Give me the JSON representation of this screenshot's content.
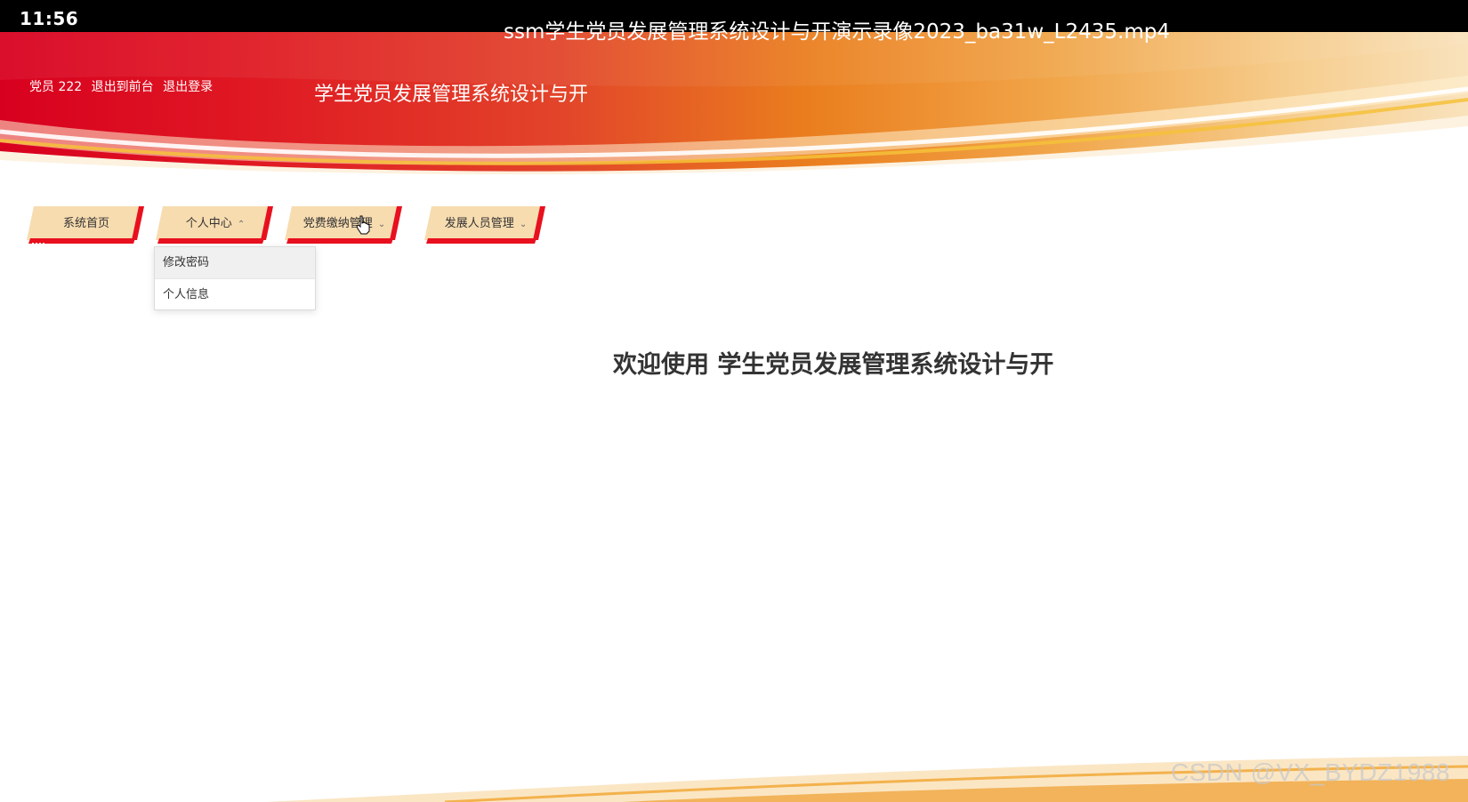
{
  "player": {
    "time": "11:56",
    "title": "ssm学生党员发展管理系统设计与开演示录像2023_ba31w_L2435.mp4"
  },
  "header": {
    "user_label": "党员 222",
    "back_front_link": "退出到前台",
    "logout_link": "退出登录",
    "site_title": "学生党员发展管理系统设计与开"
  },
  "nav": {
    "items": [
      {
        "label": "系统首页"
      },
      {
        "label": "个人中心",
        "chevron": "^"
      },
      {
        "label": "党费缴纳管理",
        "chevron": "v"
      },
      {
        "label": "发展人员管理",
        "chevron": "v"
      }
    ]
  },
  "dropdown": {
    "items": [
      {
        "label": "修改密码"
      },
      {
        "label": "个人信息"
      }
    ]
  },
  "main": {
    "welcome": "欢迎使用 学生党员发展管理系统设计与开"
  },
  "watermark": "CSDN @VX_BYDZ1988",
  "colors": {
    "banner_red": "#d8001f",
    "banner_orange": "#ea7e1e",
    "nav_bg": "#f7dcb0",
    "nav_accent": "#e8101f"
  }
}
